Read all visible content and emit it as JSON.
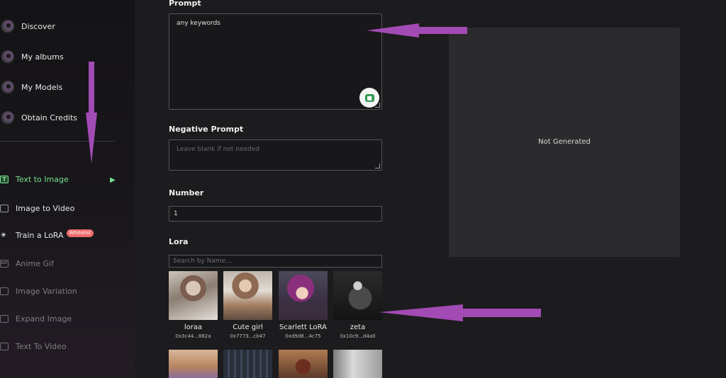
{
  "nav": [
    {
      "label": "Discover",
      "icon": "disc-icon"
    },
    {
      "label": "My albums",
      "icon": "disc-icon"
    },
    {
      "label": "My Models",
      "icon": "disc-icon"
    },
    {
      "label": "Obtain Credits",
      "icon": "disc-icon"
    }
  ],
  "tools": [
    {
      "label": "Text to Image",
      "icon": "text-t-icon",
      "state": "active"
    },
    {
      "label": "Image to Video",
      "icon": "image-icon",
      "state": "normal"
    },
    {
      "label": "Train a LoRA",
      "icon": "figure-icon",
      "state": "normal",
      "badge": "Whitelist"
    },
    {
      "label": "Anime Gif",
      "icon": "gif-icon",
      "state": "disabled",
      "icon_text": "GIF"
    },
    {
      "label": "Image Variation",
      "icon": "image-icon",
      "state": "disabled"
    },
    {
      "label": "Expand Image",
      "icon": "image-icon",
      "state": "disabled"
    },
    {
      "label": "Text To Video",
      "icon": "video-icon",
      "state": "disabled"
    }
  ],
  "form": {
    "prompt_label": "Prompt",
    "prompt_value": "any keywords",
    "negative_label": "Negative Prompt",
    "negative_placeholder": "Leave blank if not needed",
    "number_label": "Number",
    "number_value": "1",
    "lora_label": "Lora",
    "lora_search_placeholder": "Search by Name..."
  },
  "loras": [
    {
      "name": "loraa",
      "id": "0x3c44...882a"
    },
    {
      "name": "Cute girl",
      "id": "0x7773...cb47"
    },
    {
      "name": "Scarlett LoRA",
      "id": "0xd9d8...4c75"
    },
    {
      "name": "zeta",
      "id": "0x10c9...d4a0"
    }
  ],
  "preview": {
    "status": "Not Generated"
  },
  "colors": {
    "accent_green": "#77e08e",
    "annotation_purple": "#a24bb4",
    "badge_red": "#ef6b6b"
  }
}
